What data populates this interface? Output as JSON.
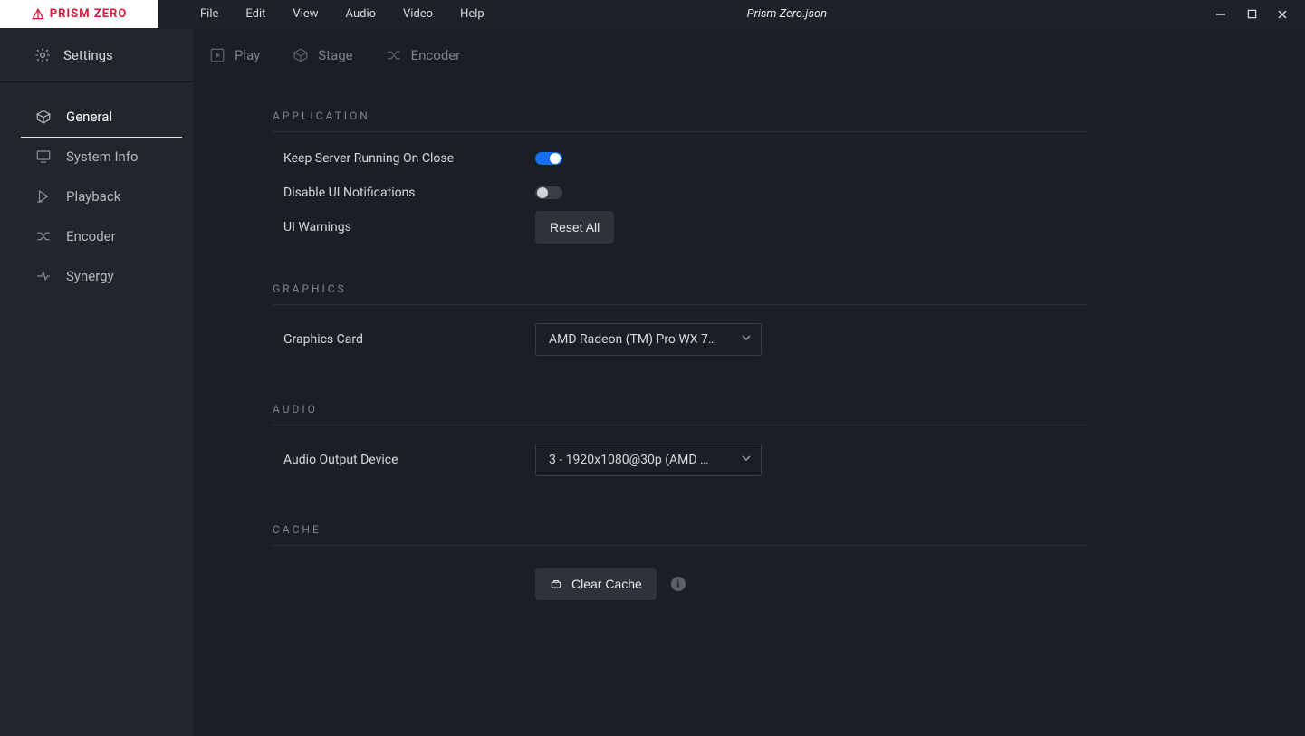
{
  "app": {
    "name": "PRISM ZERO",
    "document_title": "Prism Zero.json"
  },
  "menubar": {
    "file": "File",
    "edit": "Edit",
    "view": "View",
    "audio": "Audio",
    "video": "Video",
    "help": "Help"
  },
  "sidebar": {
    "header": "Settings",
    "items": [
      {
        "label": "General"
      },
      {
        "label": "System Info"
      },
      {
        "label": "Playback"
      },
      {
        "label": "Encoder"
      },
      {
        "label": "Synergy"
      }
    ]
  },
  "tabs": {
    "play": "Play",
    "stage": "Stage",
    "encoder": "Encoder"
  },
  "sections": {
    "application": {
      "title": "APPLICATION",
      "keep_server_label": "Keep Server Running On Close",
      "keep_server_on": true,
      "disable_notifications_label": "Disable UI Notifications",
      "disable_notifications_on": false,
      "ui_warnings_label": "UI Warnings",
      "reset_all_label": "Reset All"
    },
    "graphics": {
      "title": "GRAPHICS",
      "card_label": "Graphics Card",
      "card_value": "AMD Radeon (TM) Pro WX 7…"
    },
    "audio": {
      "title": "AUDIO",
      "device_label": "Audio Output Device",
      "device_value": "3 - 1920x1080@30p (AMD …"
    },
    "cache": {
      "title": "CACHE",
      "clear_label": "Clear Cache"
    }
  }
}
